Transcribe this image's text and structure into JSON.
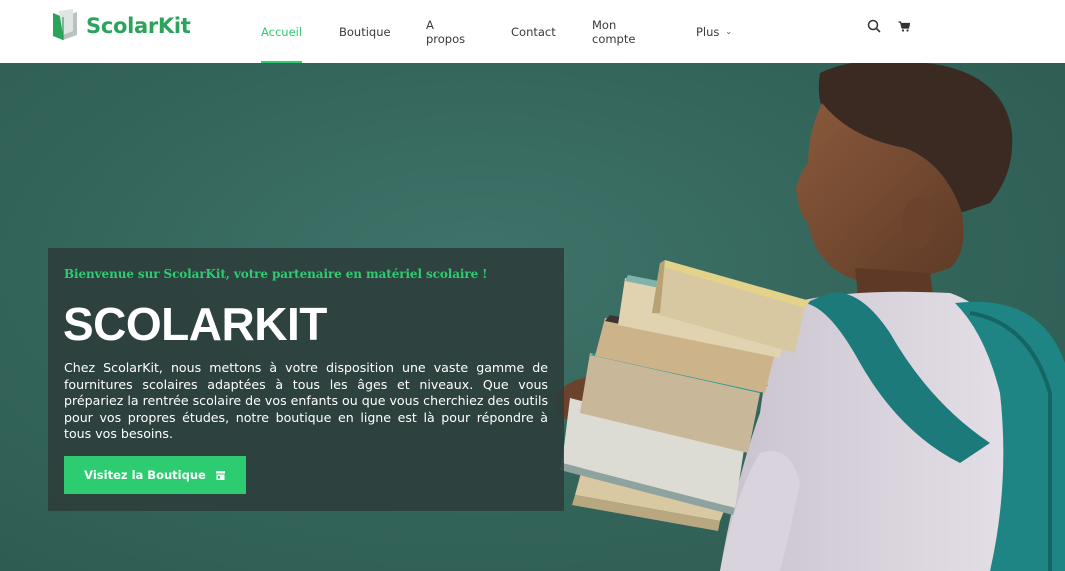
{
  "brand": {
    "name": "ScolarKit"
  },
  "nav": {
    "items": [
      {
        "label": "Accueil",
        "active": true
      },
      {
        "label": "Boutique"
      },
      {
        "label": "A propos"
      },
      {
        "label": "Contact"
      },
      {
        "label": "Mon compte"
      },
      {
        "label": "Plus",
        "has_dropdown": true
      }
    ]
  },
  "header_icons": [
    "search-icon",
    "cart-icon"
  ],
  "hero": {
    "kicker": "Bienvenue sur ScolarKit, votre partenaire en matériel scolaire !",
    "title": "SCOLARKIT",
    "body": "Chez ScolarKit, nous mettons à votre disposition une vaste gamme de fournitures scolaires adaptées à tous les âges et niveaux. Que vous prépariez la rentrée scolaire de vos enfants ou que vous cherchiez des outils pour vos propres études, notre boutique en ligne est là pour répondre à tous vos besoins.",
    "cta_label": "Visitez la Boutique",
    "cta_icon": "store-icon"
  },
  "colors": {
    "accent": "#2ecc71",
    "brand_green": "#2aa45a",
    "hero_bg": "#33645a",
    "card_bg": "#2c3c3a"
  }
}
